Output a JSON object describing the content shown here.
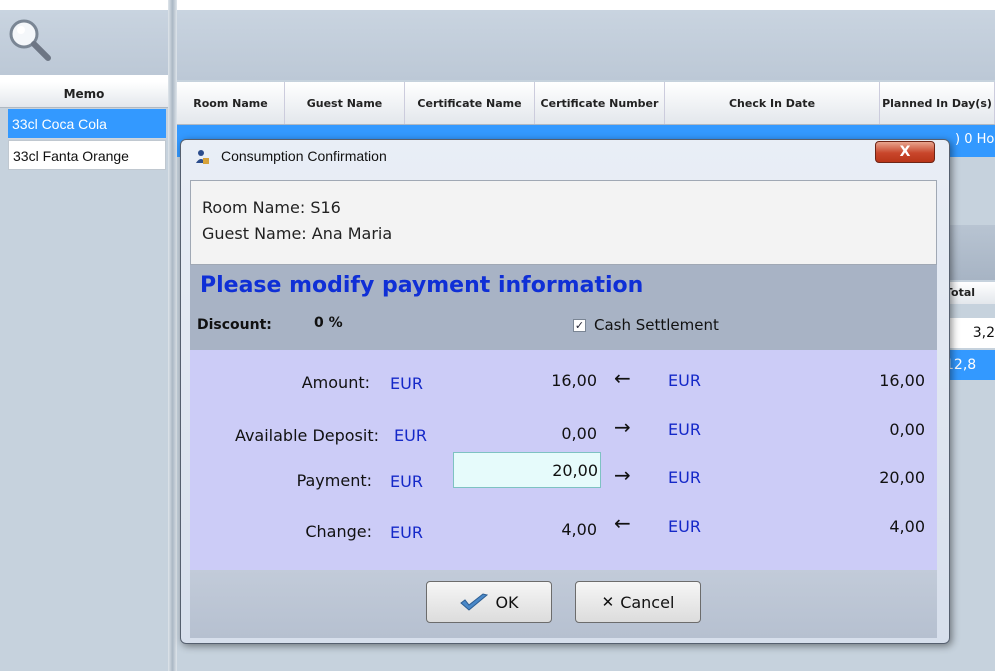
{
  "left_panel": {
    "memo_header": "Memo",
    "memo_rows": [
      "33cl Coca Cola",
      "33cl Fanta Orange"
    ]
  },
  "grid": {
    "columns": [
      "Room Name",
      "Guest Name",
      "Certificate Name",
      "Certificate Number",
      "Check In Date",
      "Planned In Day(s)"
    ],
    "row_partial": ") 0 Ho",
    "sub_header": "Total",
    "sub_rows": [
      "3,2",
      "12,8"
    ]
  },
  "dialog": {
    "title": "Consumption Confirmation",
    "close_label": "X",
    "room_name": "Room Name: S16",
    "guest_name": "Guest Name: Ana Maria",
    "heading": "Please modify payment information",
    "discount_label": "Discount:",
    "discount_value": "0 %",
    "cash_settlement_label": "Cash Settlement",
    "cash_settlement_checked": true,
    "rows": [
      {
        "label": "Amount:",
        "currency": "EUR",
        "value": "16,00",
        "arrow": "←",
        "currency2": "EUR",
        "value2": "16,00"
      },
      {
        "label": "Available Deposit:",
        "currency": "EUR",
        "value": "0,00",
        "arrow": "→",
        "currency2": "EUR",
        "value2": "0,00"
      },
      {
        "label": "Payment:",
        "currency": "EUR",
        "value": "20,00",
        "arrow": "→",
        "currency2": "EUR",
        "value2": "20,00"
      },
      {
        "label": "Change:",
        "currency": "EUR",
        "value": "4,00",
        "arrow": "←",
        "currency2": "EUR",
        "value2": "4,00"
      }
    ],
    "ok_label": "OK",
    "cancel_label": "Cancel"
  },
  "colors": {
    "selection": "#3399ff",
    "heading": "#0f2fd6",
    "currency": "#1428c8",
    "pay_panel": "#ccccf7"
  }
}
